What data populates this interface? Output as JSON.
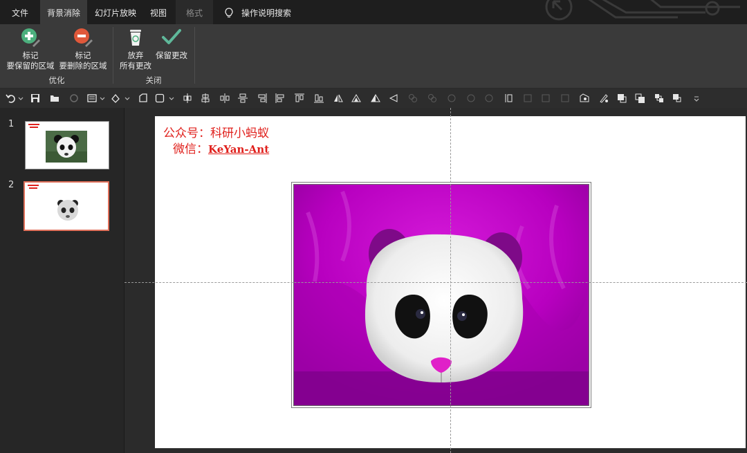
{
  "tabs": [
    {
      "label": "文件",
      "active": false
    },
    {
      "label": "背景消除",
      "active": true
    },
    {
      "label": "幻灯片放映",
      "active": false
    },
    {
      "label": "视图",
      "active": false
    },
    {
      "label": "格式",
      "active": false,
      "disabled": true
    }
  ],
  "tell_me": "操作说明搜索",
  "ribbon": {
    "groups": [
      {
        "label": "优化",
        "buttons": [
          {
            "line1": "标记",
            "line2": "要保留的区域",
            "icon": "plus-marker-icon",
            "color": "#4caf7d"
          },
          {
            "line1": "标记",
            "line2": "要删除的区域",
            "icon": "minus-marker-icon",
            "color": "#e0583a"
          }
        ]
      },
      {
        "label": "关闭",
        "buttons": [
          {
            "line1": "放弃",
            "line2": "所有更改",
            "icon": "discard-bin-icon"
          },
          {
            "line1": "保留更改",
            "line2": "",
            "icon": "checkmark-icon",
            "color": "#5fb89a"
          }
        ]
      }
    ]
  },
  "thumbnails": [
    {
      "number": "1",
      "selected": false
    },
    {
      "number": "2",
      "selected": true
    }
  ],
  "slide": {
    "watermark": {
      "line1": "公众号：科研小蚂蚁",
      "line2_prefix": "微信：",
      "line2_id": "KeYan-Ant",
      "color": "#e0201c"
    },
    "image": {
      "subject": "panda face",
      "background_color": "#c000c8"
    }
  }
}
